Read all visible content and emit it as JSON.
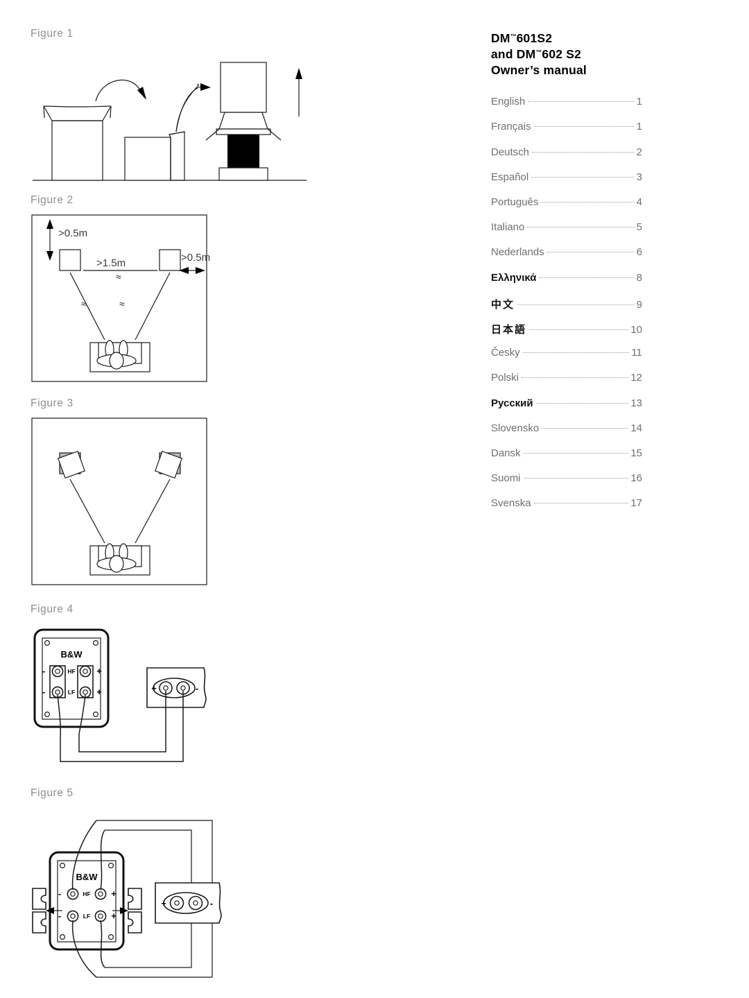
{
  "document": {
    "title_line1": "DM™601S2",
    "title_line2": "and DM™602 S2",
    "title_line3": "Owner’s manual",
    "title_brand": "DM",
    "title_model1": "601S2",
    "title_and": "and DM",
    "title_model2": "602 S2",
    "title_sub": "Owner’s manual",
    "tm_symbol": "™"
  },
  "toc": {
    "entries": [
      {
        "label": "English",
        "page": "1",
        "emphasis": "normal"
      },
      {
        "label": "Français",
        "page": "1",
        "emphasis": "normal"
      },
      {
        "label": "Deutsch",
        "page": "2",
        "emphasis": "normal"
      },
      {
        "label": "Español",
        "page": "3",
        "emphasis": "normal"
      },
      {
        "label": "Português",
        "page": "4",
        "emphasis": "normal"
      },
      {
        "label": "Italiano",
        "page": "5",
        "emphasis": "normal"
      },
      {
        "label": "Nederlands",
        "page": "6",
        "emphasis": "normal"
      },
      {
        "label": "Ελληνικά",
        "page": "8",
        "emphasis": "strong"
      },
      {
        "label": "中文",
        "page": "9",
        "emphasis": "cjk"
      },
      {
        "label": "日本語",
        "page": "10",
        "emphasis": "cjk"
      },
      {
        "label": "Česky",
        "page": "11",
        "emphasis": "normal"
      },
      {
        "label": "Polski",
        "page": "12",
        "emphasis": "normal"
      },
      {
        "label": "Русский",
        "page": "13",
        "emphasis": "strong"
      },
      {
        "label": "Slovensko",
        "page": "14",
        "emphasis": "normal"
      },
      {
        "label": "Dansk",
        "page": "15",
        "emphasis": "normal"
      },
      {
        "label": "Suomi",
        "page": "16",
        "emphasis": "normal"
      },
      {
        "label": "Svenska",
        "page": "17",
        "emphasis": "normal"
      }
    ]
  },
  "figures": {
    "fig1": {
      "label": "Figure 1",
      "caption_semantic": "unpacking-sequence",
      "steps": [
        "open-carton-flaps",
        "lay-carton-on-side",
        "lift-speaker-from-packing"
      ]
    },
    "fig2": {
      "label": "Figure 2",
      "caption_semantic": "speaker-placement-distances",
      "dim_wall_top": ">0.5m",
      "dim_between_speakers": ">1.5m",
      "dim_wall_side": ">0.5m",
      "approx_symbol": "≈"
    },
    "fig3": {
      "label": "Figure 3",
      "caption_semantic": "speaker-toe-in-angle"
    },
    "fig4": {
      "label": "Figure 4",
      "caption_semantic": "single-wire-connection",
      "brand": "B&W",
      "terminal_hf": "HF",
      "terminal_lf": "LF",
      "sign_minus": "-",
      "sign_plus": "+",
      "amp_plus": "+",
      "amp_minus": "-"
    },
    "fig5": {
      "label": "Figure 5",
      "caption_semantic": "bi-wire-connection-links-removed",
      "brand": "B&W",
      "terminal_hf": "HF",
      "terminal_lf": "LF",
      "sign_minus": "-",
      "sign_plus": "+",
      "amp_plus": "+",
      "amp_minus": "-"
    }
  }
}
